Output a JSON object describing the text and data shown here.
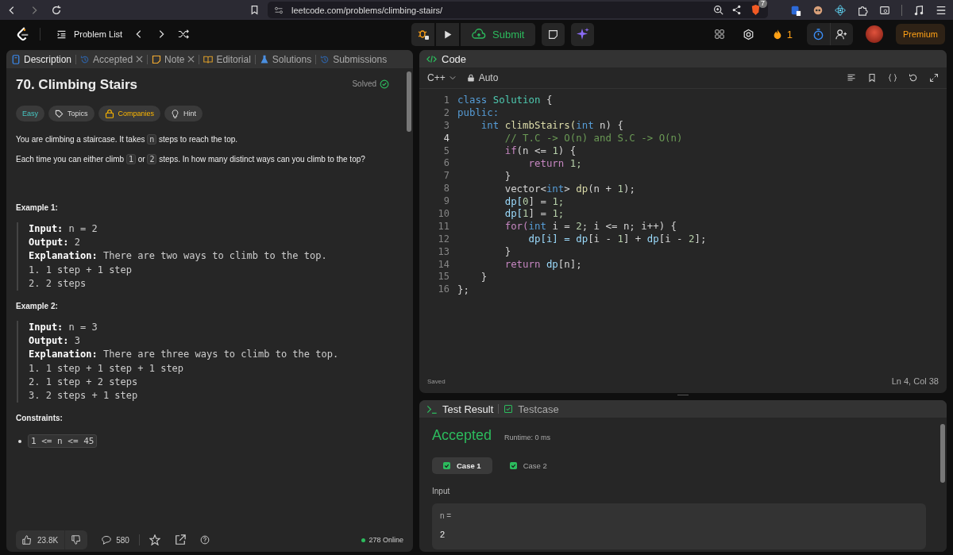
{
  "browser": {
    "url": "leetcode.com/problems/climbing-stairs/",
    "shield_count": "7"
  },
  "header": {
    "problem_list": "Problem List",
    "submit": "Submit",
    "streak": "1",
    "premium": "Premium"
  },
  "left_tabs": [
    {
      "label": "Description",
      "selected": true,
      "closable": false,
      "kind": "doc"
    },
    {
      "label": "Accepted",
      "selected": false,
      "closable": true,
      "kind": "history"
    },
    {
      "label": "Note",
      "selected": false,
      "closable": true,
      "kind": "note"
    },
    {
      "label": "Editorial",
      "selected": false,
      "closable": false,
      "kind": "book"
    },
    {
      "label": "Solutions",
      "selected": false,
      "closable": false,
      "kind": "flask"
    },
    {
      "label": "Submissions",
      "selected": false,
      "closable": false,
      "kind": "history"
    }
  ],
  "problem": {
    "title": "70. Climbing Stairs",
    "status": "Solved",
    "tags": [
      {
        "label": "Easy",
        "kind": "difficulty"
      },
      {
        "label": "Topics",
        "kind": "tag"
      },
      {
        "label": "Companies",
        "kind": "locked"
      },
      {
        "label": "Hint",
        "kind": "bulb"
      }
    ],
    "paragraphs": [
      [
        {
          "text": "You are climbing a staircase. It takes ",
          "code": false
        },
        {
          "text": "n",
          "code": true
        },
        {
          "text": " steps to reach the top.",
          "code": false
        }
      ],
      [
        {
          "text": "Each time you can either climb ",
          "code": false
        },
        {
          "text": "1",
          "code": true
        },
        {
          "text": " or ",
          "code": false
        },
        {
          "text": "2",
          "code": true
        },
        {
          "text": " steps. In how many distinct ways can you climb to the top?",
          "code": false
        }
      ]
    ],
    "examples": [
      {
        "heading": "Example 1:",
        "lines": [
          "**Input:** n = 2",
          "**Output:** 2",
          "**Explanation:** There are two ways to climb to the top.",
          "1. 1 step + 1 step",
          "2. 2 steps"
        ]
      },
      {
        "heading": "Example 2:",
        "lines": [
          "**Input:** n = 3",
          "**Output:** 3",
          "**Explanation:** There are three ways to climb to the top.",
          "1. 1 step + 1 step + 1 step",
          "2. 1 step + 2 steps",
          "3. 2 steps + 1 step"
        ]
      }
    ],
    "constraints_heading": "Constraints:",
    "constraints": [
      "1 <= n <= 45"
    ]
  },
  "footer": {
    "likes": "23.8K",
    "comments": "580",
    "online": "278 Online"
  },
  "code_panel": {
    "title": "Code",
    "language": "C++",
    "mode": "Auto",
    "status": "Saved",
    "cursor": "Ln 4, Col 38",
    "lines": [
      {
        "number": "1",
        "current": false,
        "segments": [
          {
            "text": "class ",
            "color": "#569cd6"
          },
          {
            "text": "Solution",
            "color": "#4ec9b0"
          },
          {
            "text": " {",
            "color": "#d4d4d4"
          }
        ]
      },
      {
        "number": "2",
        "current": false,
        "segments": [
          {
            "text": "public:",
            "color": "#569cd6"
          }
        ]
      },
      {
        "number": "3",
        "current": false,
        "segments": [
          {
            "text": "    int ",
            "color": "#569cd6"
          },
          {
            "text": "climbStairs(",
            "color": "#dcdcaa"
          },
          {
            "text": "int ",
            "color": "#569cd6"
          },
          {
            "text": "n) {",
            "color": "#d4d4d4"
          }
        ]
      },
      {
        "number": "4",
        "current": true,
        "segments": [
          {
            "text": "        // T.C -> O(n) and S.C -> O(n)",
            "color": "#6a9955"
          }
        ]
      },
      {
        "number": "5",
        "current": false,
        "segments": [
          {
            "text": "        if",
            "color": "#c586c0"
          },
          {
            "text": "(n <= ",
            "color": "#d4d4d4"
          },
          {
            "text": "1",
            "color": "#b5cea8"
          },
          {
            "text": ") {",
            "color": "#d4d4d4"
          }
        ]
      },
      {
        "number": "6",
        "current": false,
        "segments": [
          {
            "text": "            return ",
            "color": "#c586c0"
          },
          {
            "text": "1;",
            "color": "#b5cea8"
          }
        ]
      },
      {
        "number": "7",
        "current": false,
        "segments": [
          {
            "text": "        }",
            "color": "#d4d4d4"
          }
        ]
      },
      {
        "number": "8",
        "current": false,
        "segments": [
          {
            "text": "        vector<",
            "color": "#d4d4d4"
          },
          {
            "text": "int",
            "color": "#569cd6"
          },
          {
            "text": "> ",
            "color": "#d4d4d4"
          },
          {
            "text": "dp",
            "color": "#dcdcaa"
          },
          {
            "text": "(n + ",
            "color": "#d4d4d4"
          },
          {
            "text": "1",
            "color": "#b5cea8"
          },
          {
            "text": ");",
            "color": "#d4d4d4"
          }
        ]
      },
      {
        "number": "9",
        "current": false,
        "segments": [
          {
            "text": "        dp[",
            "color": "#9cdcfe"
          },
          {
            "text": "0",
            "color": "#b5cea8"
          },
          {
            "text": "] = ",
            "color": "#d4d4d4"
          },
          {
            "text": "1;",
            "color": "#b5cea8"
          }
        ]
      },
      {
        "number": "10",
        "current": false,
        "segments": [
          {
            "text": "        dp[",
            "color": "#9cdcfe"
          },
          {
            "text": "1",
            "color": "#b5cea8"
          },
          {
            "text": "] = ",
            "color": "#d4d4d4"
          },
          {
            "text": "1;",
            "color": "#b5cea8"
          }
        ]
      },
      {
        "number": "11",
        "current": false,
        "segments": [
          {
            "text": "        for(",
            "color": "#c586c0"
          },
          {
            "text": "int ",
            "color": "#569cd6"
          },
          {
            "text": "i = ",
            "color": "#d4d4d4"
          },
          {
            "text": "2",
            "color": "#b5cea8"
          },
          {
            "text": "; i <= n; i++) {",
            "color": "#d4d4d4"
          }
        ]
      },
      {
        "number": "12",
        "current": false,
        "segments": [
          {
            "text": "            dp[i] = dp",
            "color": "#9cdcfe"
          },
          {
            "text": "[i - ",
            "color": "#d4d4d4"
          },
          {
            "text": "1",
            "color": "#b5cea8"
          },
          {
            "text": "] + ",
            "color": "#d4d4d4"
          },
          {
            "text": "dp",
            "color": "#9cdcfe"
          },
          {
            "text": "[i - ",
            "color": "#d4d4d4"
          },
          {
            "text": "2",
            "color": "#b5cea8"
          },
          {
            "text": "];",
            "color": "#d4d4d4"
          }
        ]
      },
      {
        "number": "13",
        "current": false,
        "segments": [
          {
            "text": "        }",
            "color": "#d4d4d4"
          }
        ]
      },
      {
        "number": "14",
        "current": false,
        "segments": [
          {
            "text": "        return ",
            "color": "#c586c0"
          },
          {
            "text": "dp",
            "color": "#9cdcfe"
          },
          {
            "text": "[n];",
            "color": "#d4d4d4"
          }
        ]
      },
      {
        "number": "15",
        "current": false,
        "segments": [
          {
            "text": "    }",
            "color": "#d4d4d4"
          }
        ]
      },
      {
        "number": "16",
        "current": false,
        "segments": [
          {
            "text": "};",
            "color": "#d4d4d4"
          }
        ]
      }
    ]
  },
  "result_tabs": [
    {
      "label": "Test Result",
      "selected": true,
      "kind": "terminal"
    },
    {
      "label": "Testcase",
      "selected": false,
      "kind": "check"
    }
  ],
  "result": {
    "verdict": "Accepted",
    "runtime": "Runtime: 0 ms",
    "cases": [
      {
        "label": "Case 1",
        "selected": true
      },
      {
        "label": "Case 2",
        "selected": false
      }
    ],
    "input_label": "Input",
    "param": "n =",
    "value": "2"
  }
}
